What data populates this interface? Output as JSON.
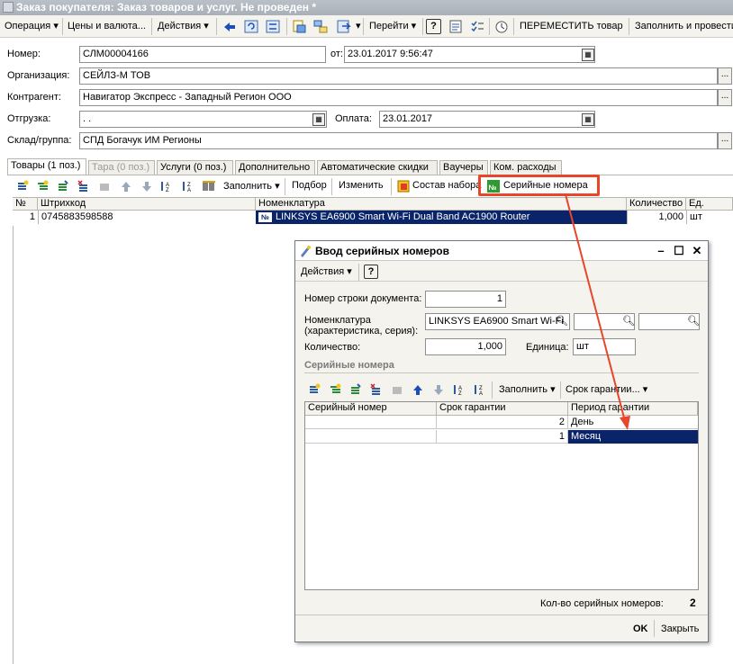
{
  "window": {
    "title": "Заказ покупателя: Заказ товаров и услуг. Не проведен *"
  },
  "toolbar": {
    "operation": "Операция",
    "prices": "Цены и валюта...",
    "actions": "Действия",
    "goto": "Перейти",
    "help": "?",
    "move_goods": "ПЕРЕМЕСТИТЬ товар",
    "fill_and_post": "Заполнить и провести"
  },
  "form": {
    "number_label": "Номер:",
    "number_value": "СЛМ00004166",
    "date_label": "от:",
    "date_value": "23.01.2017  9:56:47",
    "org_label": "Организация:",
    "org_value": "СЕЙЛЗ-М ТОВ",
    "contractor_label": "Контрагент:",
    "contractor_value": "Навигатор Экспресс - Западный Регион ООО",
    "shipment_label": "Отгрузка:",
    "shipment_value": "  .  .",
    "payment_label": "Оплата:",
    "payment_value": "23.01.2017",
    "warehouse_label": "Склад/группа:",
    "warehouse_value": "СПД Богачук ИМ Регионы",
    "dots": "..."
  },
  "tabs": [
    {
      "label": "Товары (1 поз.)"
    },
    {
      "label": "Тара (0 поз.)"
    },
    {
      "label": "Услуги (0 поз.)"
    },
    {
      "label": "Дополнительно"
    },
    {
      "label": "Автоматические скидки"
    },
    {
      "label": "Ваучеры"
    },
    {
      "label": "Ком. расходы"
    }
  ],
  "goods_toolbar": {
    "fill": "Заполнить",
    "selection": "Подбор",
    "change": "Изменить",
    "kit": "Состав набора",
    "serials": "Серийные номера"
  },
  "goods_table": {
    "headers": [
      "№",
      "Штрихкод",
      "Номенклатура",
      "Количество",
      "Ед."
    ],
    "rows": [
      {
        "num": "1",
        "barcode": "0745883598588",
        "item": "LINKSYS EA6900 Smart Wi-Fi Dual Band AC1900 Router",
        "qty": "1,000",
        "unit": "шт"
      }
    ],
    "item_badge": "№"
  },
  "dialog": {
    "title": "Ввод серийных номеров",
    "actions": "Действия",
    "help": "?",
    "row_label": "Номер строки документа:",
    "row_value": "1",
    "item_label_1": "Номенклатура",
    "item_label_2": "(характеристика, серия):",
    "item_value": "LINKSYS EA6900 Smart Wi-Fi",
    "qty_label": "Количество:",
    "qty_value": "1,000",
    "unit_label": "Единица:",
    "unit_value": "шт",
    "section_title": "Серийные номера",
    "fill": "Заполнить",
    "warranty_menu": "Срок гарантии...",
    "headers": [
      "Серийный номер",
      "Срок гарантии",
      "Период гарантии"
    ],
    "rows": [
      {
        "serial": "",
        "term": "2",
        "period": "День"
      },
      {
        "serial": "",
        "term": "1",
        "period": "Месяц"
      }
    ],
    "count_label": "Кол-во серийных номеров:",
    "count_value": "2",
    "ok": "OK",
    "close": "Закрыть"
  },
  "colors": {
    "highlight": "#e8462a",
    "selection": "#0a246a"
  }
}
